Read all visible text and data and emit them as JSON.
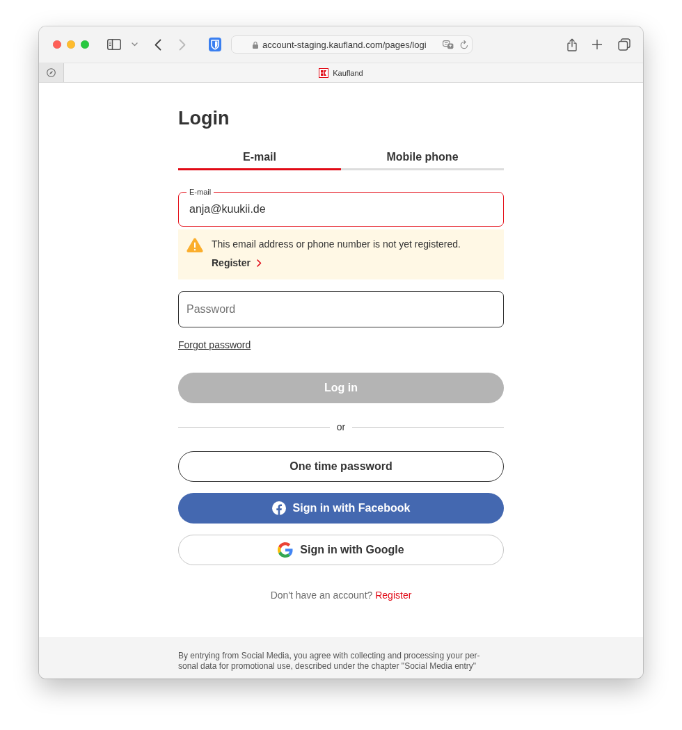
{
  "browser": {
    "url": "account-staging.kaufland.com/pages/logi",
    "tab_title": "Kaufland",
    "back_disabled": false,
    "forward_disabled": true
  },
  "page": {
    "title": "Login",
    "tabs": [
      {
        "label": "E-mail",
        "selected": true
      },
      {
        "label": "Mobile phone",
        "selected": false
      }
    ],
    "email_field": {
      "label": "E-mail",
      "value": "anja@kuukii.de",
      "error": true
    },
    "warning": {
      "message": "This email address or phone number is not yet registered.",
      "link": "Register"
    },
    "password_field": {
      "placeholder": "Password"
    },
    "forgot_link": "Forgot password",
    "login_button": {
      "label": "Log in",
      "disabled": true
    },
    "divider": "or",
    "buttons": [
      {
        "kind": "outline",
        "label": "One time password"
      },
      {
        "kind": "facebook",
        "label": "Sign in with Facebook"
      },
      {
        "kind": "google",
        "label": "Sign in with Google"
      }
    ],
    "signup": {
      "prompt": "Don't have an account?",
      "link": "Register"
    }
  },
  "footer": {
    "lines": [
      "By entrying from Social Media, you agree with collecting and processing your per-",
      "sonal data for promotional use, described under the chapter \"Social Media entry\""
    ]
  }
}
